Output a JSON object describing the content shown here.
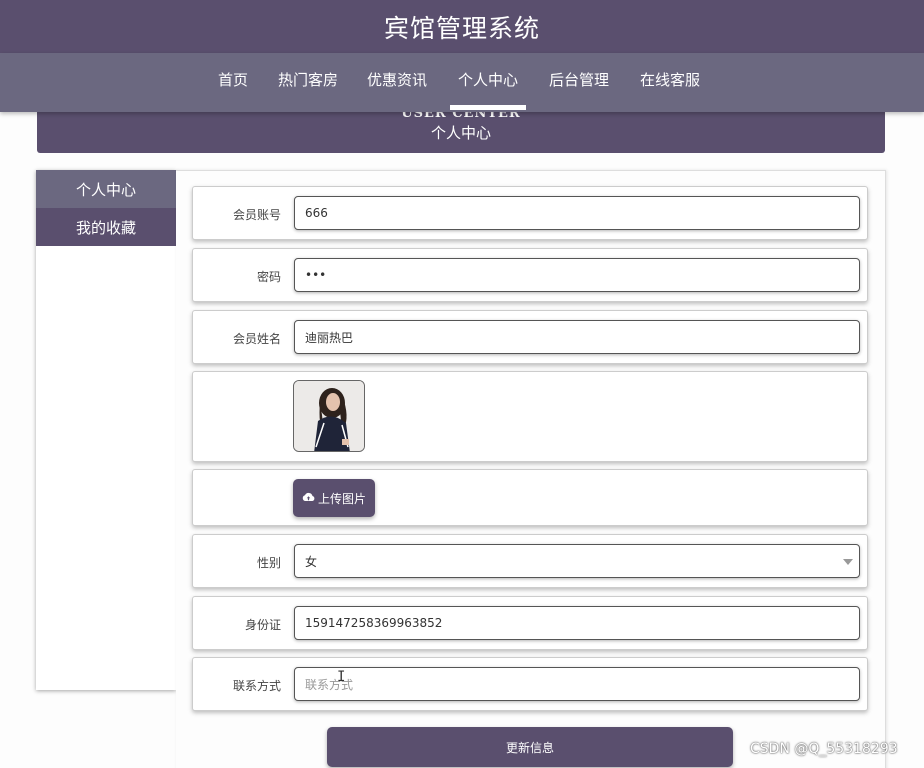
{
  "header": {
    "site_title": "宾馆管理系统"
  },
  "nav": {
    "items": [
      {
        "label": "首页"
      },
      {
        "label": "热门客房"
      },
      {
        "label": "优惠资讯"
      },
      {
        "label": "个人中心"
      },
      {
        "label": "后台管理"
      },
      {
        "label": "在线客服"
      }
    ],
    "active": "个人中心"
  },
  "banner": {
    "english": "USER CENTER",
    "title": "个人中心"
  },
  "sidebar": {
    "items": [
      {
        "label": "个人中心"
      },
      {
        "label": "我的收藏"
      }
    ]
  },
  "form": {
    "account": {
      "label": "会员账号",
      "value": "666"
    },
    "password": {
      "label": "密码",
      "value": "•••"
    },
    "name": {
      "label": "会员姓名",
      "value": "迪丽热巴"
    },
    "upload_label": "上传图片",
    "gender": {
      "label": "性别",
      "value": "女"
    },
    "id_card": {
      "label": "身份证",
      "value": "159147258369963852"
    },
    "contact": {
      "label": "联系方式",
      "placeholder": "联系方式"
    },
    "submit_label": "更新信息"
  },
  "watermark": "CSDN @Q_55318293",
  "colors": {
    "primary": "#5a4f6e",
    "nav": "#6b6880"
  }
}
